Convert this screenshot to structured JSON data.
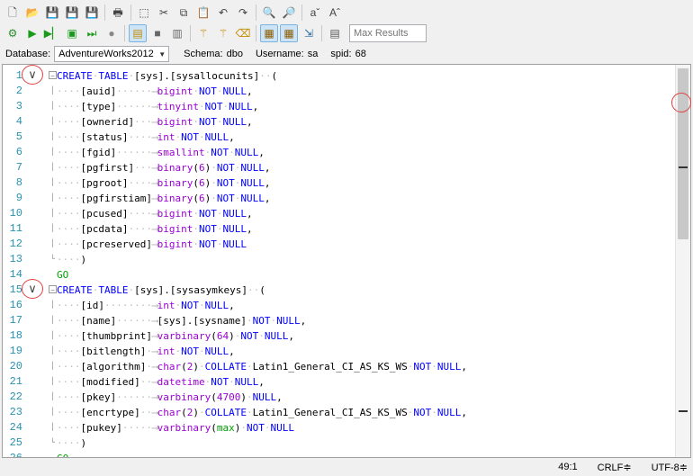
{
  "toolbar1": {
    "buttons": [
      {
        "name": "new-document-icon",
        "glyph": "🗋"
      },
      {
        "name": "open-icon",
        "glyph": "📂"
      },
      {
        "name": "save-icon",
        "glyph": "💾"
      },
      {
        "name": "save-as-icon",
        "glyph": "💾"
      },
      {
        "name": "save-all-icon",
        "glyph": "💾"
      },
      {
        "name": "print-icon",
        "glyph": "🖶"
      },
      {
        "name": "select-all-icon",
        "glyph": "⬚"
      },
      {
        "name": "cut-icon",
        "glyph": "✂"
      },
      {
        "name": "copy-icon",
        "glyph": "⧉"
      },
      {
        "name": "paste-icon",
        "glyph": "📋"
      },
      {
        "name": "undo-icon",
        "glyph": "↶"
      },
      {
        "name": "redo-icon",
        "glyph": "↷"
      },
      {
        "name": "find-icon",
        "glyph": "🔍"
      },
      {
        "name": "replace-icon",
        "glyph": "🔎"
      },
      {
        "name": "decrease-font-icon",
        "glyph": "aˇ"
      },
      {
        "name": "increase-font-icon",
        "glyph": "Aˆ"
      }
    ]
  },
  "toolbar2": {
    "max_results_placeholder": "Max Results"
  },
  "info": {
    "database_label": "Database:",
    "database_value": "AdventureWorks2012",
    "schema_label": "Schema:",
    "schema_value": "dbo",
    "username_label": "Username:",
    "username_value": "sa",
    "spid_label": "spid:",
    "spid_value": "68"
  },
  "status": {
    "position": "49:1",
    "line_ending": "CRLF≑",
    "encoding": "UTF-8≑"
  },
  "code_lines": [
    {
      "n": "1",
      "fold": "box",
      "t": [
        [
          "kw",
          "CREATE"
        ],
        [
          "ws",
          "·"
        ],
        [
          "kw",
          "TABLE"
        ],
        [
          "ws",
          "·"
        ],
        [
          "",
          "[sys].[sysallocunits]"
        ],
        [
          "ws",
          "··"
        ],
        [
          "",
          "("
        ]
      ]
    },
    {
      "n": "2",
      "fold": "bar",
      "t": [
        [
          "ws",
          "····"
        ],
        [
          "",
          "[auid]"
        ],
        [
          "ws",
          "······"
        ],
        [
          "ar",
          "⟶"
        ],
        [
          "ty",
          "bigint"
        ],
        [
          "ws",
          "·"
        ],
        [
          "kw",
          "NOT"
        ],
        [
          "ws",
          "·"
        ],
        [
          "kw",
          "NULL"
        ],
        [
          "",
          ","
        ]
      ]
    },
    {
      "n": "3",
      "fold": "bar",
      "t": [
        [
          "ws",
          "····"
        ],
        [
          "",
          "[type]"
        ],
        [
          "ws",
          "······"
        ],
        [
          "ar",
          "⟶"
        ],
        [
          "ty",
          "tinyint"
        ],
        [
          "ws",
          "·"
        ],
        [
          "kw",
          "NOT"
        ],
        [
          "ws",
          "·"
        ],
        [
          "kw",
          "NULL"
        ],
        [
          "",
          ","
        ]
      ]
    },
    {
      "n": "4",
      "fold": "bar",
      "t": [
        [
          "ws",
          "····"
        ],
        [
          "",
          "[ownerid]"
        ],
        [
          "ws",
          "···"
        ],
        [
          "ar",
          "⟶"
        ],
        [
          "ty",
          "bigint"
        ],
        [
          "ws",
          "·"
        ],
        [
          "kw",
          "NOT"
        ],
        [
          "ws",
          "·"
        ],
        [
          "kw",
          "NULL"
        ],
        [
          "",
          ","
        ]
      ]
    },
    {
      "n": "5",
      "fold": "bar",
      "t": [
        [
          "ws",
          "····"
        ],
        [
          "",
          "[status]"
        ],
        [
          "ws",
          "····"
        ],
        [
          "ar",
          "⟶"
        ],
        [
          "ty",
          "int"
        ],
        [
          "ws",
          "·"
        ],
        [
          "kw",
          "NOT"
        ],
        [
          "ws",
          "·"
        ],
        [
          "kw",
          "NULL"
        ],
        [
          "",
          ","
        ]
      ]
    },
    {
      "n": "6",
      "fold": "bar",
      "t": [
        [
          "ws",
          "····"
        ],
        [
          "",
          "[fgid]"
        ],
        [
          "ws",
          "······"
        ],
        [
          "ar",
          "⟶"
        ],
        [
          "ty",
          "smallint"
        ],
        [
          "ws",
          "·"
        ],
        [
          "kw",
          "NOT"
        ],
        [
          "ws",
          "·"
        ],
        [
          "kw",
          "NULL"
        ],
        [
          "",
          ","
        ]
      ]
    },
    {
      "n": "7",
      "fold": "bar",
      "t": [
        [
          "ws",
          "····"
        ],
        [
          "",
          "[pgfirst]"
        ],
        [
          "ws",
          "···"
        ],
        [
          "ar",
          "⟶"
        ],
        [
          "ty",
          "binary"
        ],
        [
          "",
          "("
        ],
        [
          "ty",
          "6"
        ],
        [
          "",
          ")"
        ],
        [
          "ws",
          "·"
        ],
        [
          "kw",
          "NOT"
        ],
        [
          "ws",
          "·"
        ],
        [
          "kw",
          "NULL"
        ],
        [
          "",
          ","
        ]
      ]
    },
    {
      "n": "8",
      "fold": "bar",
      "t": [
        [
          "ws",
          "····"
        ],
        [
          "",
          "[pgroot]"
        ],
        [
          "ws",
          "····"
        ],
        [
          "ar",
          "⟶"
        ],
        [
          "ty",
          "binary"
        ],
        [
          "",
          "("
        ],
        [
          "ty",
          "6"
        ],
        [
          "",
          ")"
        ],
        [
          "ws",
          "·"
        ],
        [
          "kw",
          "NOT"
        ],
        [
          "ws",
          "·"
        ],
        [
          "kw",
          "NULL"
        ],
        [
          "",
          ","
        ]
      ]
    },
    {
      "n": "9",
      "fold": "bar",
      "t": [
        [
          "ws",
          "····"
        ],
        [
          "",
          "[pgfirstiam]"
        ],
        [
          "ar",
          "⟶"
        ],
        [
          "ty",
          "binary"
        ],
        [
          "",
          "("
        ],
        [
          "ty",
          "6"
        ],
        [
          "",
          ")"
        ],
        [
          "ws",
          "·"
        ],
        [
          "kw",
          "NOT"
        ],
        [
          "ws",
          "·"
        ],
        [
          "kw",
          "NULL"
        ],
        [
          "",
          ","
        ]
      ]
    },
    {
      "n": "10",
      "fold": "bar",
      "t": [
        [
          "ws",
          "····"
        ],
        [
          "",
          "[pcused]"
        ],
        [
          "ws",
          "····"
        ],
        [
          "ar",
          "⟶"
        ],
        [
          "ty",
          "bigint"
        ],
        [
          "ws",
          "·"
        ],
        [
          "kw",
          "NOT"
        ],
        [
          "ws",
          "·"
        ],
        [
          "kw",
          "NULL"
        ],
        [
          "",
          ","
        ]
      ]
    },
    {
      "n": "11",
      "fold": "bar",
      "t": [
        [
          "ws",
          "····"
        ],
        [
          "",
          "[pcdata]"
        ],
        [
          "ws",
          "····"
        ],
        [
          "ar",
          "⟶"
        ],
        [
          "ty",
          "bigint"
        ],
        [
          "ws",
          "·"
        ],
        [
          "kw",
          "NOT"
        ],
        [
          "ws",
          "·"
        ],
        [
          "kw",
          "NULL"
        ],
        [
          "",
          ","
        ]
      ]
    },
    {
      "n": "12",
      "fold": "bar",
      "t": [
        [
          "ws",
          "····"
        ],
        [
          "",
          "[pcreserved]"
        ],
        [
          "ar",
          "⟶"
        ],
        [
          "ty",
          "bigint"
        ],
        [
          "ws",
          "·"
        ],
        [
          "kw",
          "NOT"
        ],
        [
          "ws",
          "·"
        ],
        [
          "kw",
          "NULL"
        ]
      ]
    },
    {
      "n": "13",
      "fold": "end",
      "t": [
        [
          "ws",
          "····"
        ],
        [
          "",
          ")"
        ]
      ]
    },
    {
      "n": "14",
      "fold": "",
      "t": [
        [
          "gr",
          "GO"
        ]
      ]
    },
    {
      "n": "15",
      "fold": "box",
      "t": [
        [
          "kw",
          "CREATE"
        ],
        [
          "ws",
          "·"
        ],
        [
          "kw",
          "TABLE"
        ],
        [
          "ws",
          "·"
        ],
        [
          "",
          "[sys].[sysasymkeys]"
        ],
        [
          "ws",
          "··"
        ],
        [
          "",
          "("
        ]
      ]
    },
    {
      "n": "16",
      "fold": "bar",
      "t": [
        [
          "ws",
          "····"
        ],
        [
          "",
          "[id]"
        ],
        [
          "ws",
          "········"
        ],
        [
          "ar",
          "⟶"
        ],
        [
          "ty",
          "int"
        ],
        [
          "ws",
          "·"
        ],
        [
          "kw",
          "NOT"
        ],
        [
          "ws",
          "·"
        ],
        [
          "kw",
          "NULL"
        ],
        [
          "",
          ","
        ]
      ]
    },
    {
      "n": "17",
      "fold": "bar",
      "t": [
        [
          "ws",
          "····"
        ],
        [
          "",
          "[name]"
        ],
        [
          "ws",
          "······"
        ],
        [
          "ar",
          "⟶"
        ],
        [
          "",
          "[sys].[sysname]"
        ],
        [
          "ws",
          "·"
        ],
        [
          "kw",
          "NOT"
        ],
        [
          "ws",
          "·"
        ],
        [
          "kw",
          "NULL"
        ],
        [
          "",
          ","
        ]
      ]
    },
    {
      "n": "18",
      "fold": "bar",
      "t": [
        [
          "ws",
          "····"
        ],
        [
          "",
          "[thumbprint]"
        ],
        [
          "ar",
          "⟶"
        ],
        [
          "ty",
          "varbinary"
        ],
        [
          "",
          "("
        ],
        [
          "ty",
          "64"
        ],
        [
          "",
          ")"
        ],
        [
          "ws",
          "·"
        ],
        [
          "kw",
          "NOT"
        ],
        [
          "ws",
          "·"
        ],
        [
          "kw",
          "NULL"
        ],
        [
          "",
          ","
        ]
      ]
    },
    {
      "n": "19",
      "fold": "bar",
      "t": [
        [
          "ws",
          "····"
        ],
        [
          "",
          "[bitlength]"
        ],
        [
          "ws",
          "·"
        ],
        [
          "ar",
          "⟶"
        ],
        [
          "ty",
          "int"
        ],
        [
          "ws",
          "·"
        ],
        [
          "kw",
          "NOT"
        ],
        [
          "ws",
          "·"
        ],
        [
          "kw",
          "NULL"
        ],
        [
          "",
          ","
        ]
      ]
    },
    {
      "n": "20",
      "fold": "bar",
      "t": [
        [
          "ws",
          "····"
        ],
        [
          "",
          "[algorithm]"
        ],
        [
          "ws",
          "·"
        ],
        [
          "ar",
          "⟶"
        ],
        [
          "ty",
          "char"
        ],
        [
          "",
          "("
        ],
        [
          "ty",
          "2"
        ],
        [
          "",
          ")"
        ],
        [
          "ws",
          "·"
        ],
        [
          "kw",
          "COLLATE"
        ],
        [
          "ws",
          "·"
        ],
        [
          "",
          "Latin1_General_CI_AS_KS_WS"
        ],
        [
          "ws",
          "·"
        ],
        [
          "kw",
          "NOT"
        ],
        [
          "ws",
          "·"
        ],
        [
          "kw",
          "NULL"
        ],
        [
          "",
          ","
        ]
      ]
    },
    {
      "n": "21",
      "fold": "bar",
      "t": [
        [
          "ws",
          "····"
        ],
        [
          "",
          "[modified]"
        ],
        [
          "ws",
          "··"
        ],
        [
          "ar",
          "⟶"
        ],
        [
          "ty",
          "datetime"
        ],
        [
          "ws",
          "·"
        ],
        [
          "kw",
          "NOT"
        ],
        [
          "ws",
          "·"
        ],
        [
          "kw",
          "NULL"
        ],
        [
          "",
          ","
        ]
      ]
    },
    {
      "n": "22",
      "fold": "bar",
      "t": [
        [
          "ws",
          "····"
        ],
        [
          "",
          "[pkey]"
        ],
        [
          "ws",
          "······"
        ],
        [
          "ar",
          "⟶"
        ],
        [
          "ty",
          "varbinary"
        ],
        [
          "",
          "("
        ],
        [
          "ty",
          "4700"
        ],
        [
          "",
          ")"
        ],
        [
          "ws",
          "·"
        ],
        [
          "kw",
          "NULL"
        ],
        [
          "",
          ","
        ]
      ]
    },
    {
      "n": "23",
      "fold": "bar",
      "t": [
        [
          "ws",
          "····"
        ],
        [
          "",
          "[encrtype]"
        ],
        [
          "ws",
          "··"
        ],
        [
          "ar",
          "⟶"
        ],
        [
          "ty",
          "char"
        ],
        [
          "",
          "("
        ],
        [
          "ty",
          "2"
        ],
        [
          "",
          ")"
        ],
        [
          "ws",
          "·"
        ],
        [
          "kw",
          "COLLATE"
        ],
        [
          "ws",
          "·"
        ],
        [
          "",
          "Latin1_General_CI_AS_KS_WS"
        ],
        [
          "ws",
          "·"
        ],
        [
          "kw",
          "NOT"
        ],
        [
          "ws",
          "·"
        ],
        [
          "kw",
          "NULL"
        ],
        [
          "",
          ","
        ]
      ]
    },
    {
      "n": "24",
      "fold": "bar",
      "t": [
        [
          "ws",
          "····"
        ],
        [
          "",
          "[pukey]"
        ],
        [
          "ws",
          "·····"
        ],
        [
          "ar",
          "⟶"
        ],
        [
          "ty",
          "varbinary"
        ],
        [
          "",
          "("
        ],
        [
          "gr",
          "max"
        ],
        [
          "",
          ")"
        ],
        [
          "ws",
          "·"
        ],
        [
          "kw",
          "NOT"
        ],
        [
          "ws",
          "·"
        ],
        [
          "kw",
          "NULL"
        ]
      ]
    },
    {
      "n": "25",
      "fold": "end",
      "t": [
        [
          "ws",
          "····"
        ],
        [
          "",
          ")"
        ]
      ]
    },
    {
      "n": "26",
      "fold": "",
      "t": [
        [
          "gr",
          "GO"
        ]
      ]
    }
  ]
}
